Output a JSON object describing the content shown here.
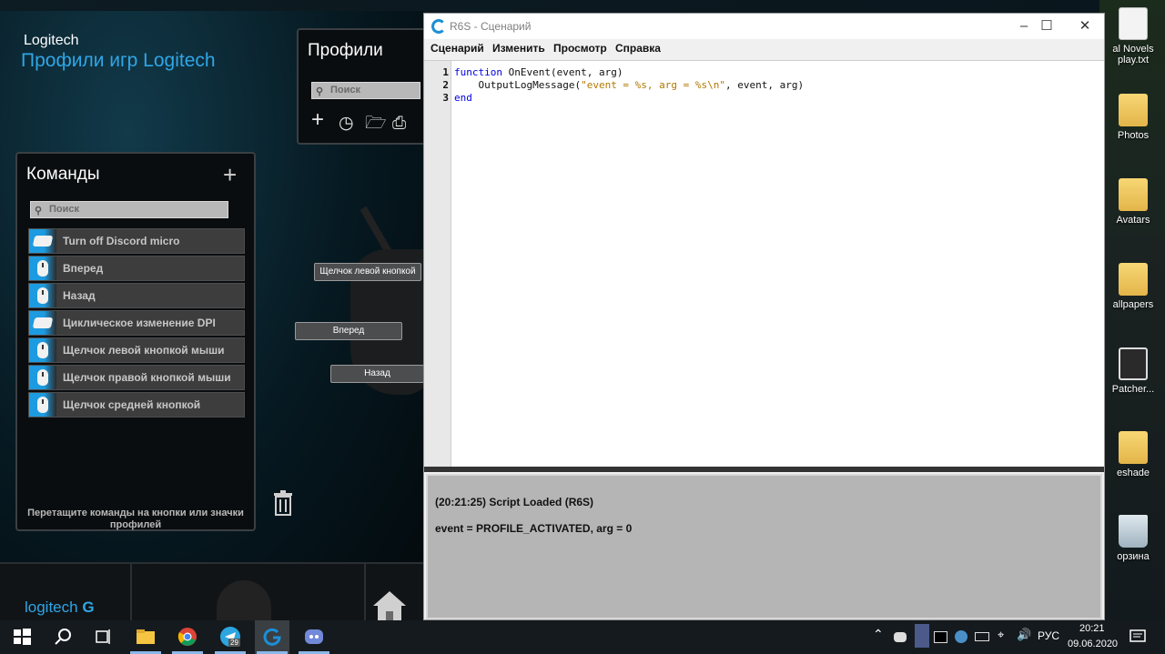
{
  "logitech": {
    "brand": "Logitech",
    "title": "Профили игр Logitech",
    "profiles": {
      "title": "Профили",
      "search_placeholder": "Поиск"
    },
    "commands": {
      "title": "Команды",
      "add": "+",
      "search_placeholder": "Поиск",
      "items": [
        {
          "label": "Turn off Discord micro",
          "icon": "keyboard-icon"
        },
        {
          "label": "Вперед",
          "icon": "mouse-icon"
        },
        {
          "label": "Назад",
          "icon": "mouse-icon"
        },
        {
          "label": "Циклическое изменение DPI",
          "icon": "keyboard-icon"
        },
        {
          "label": "Щелчок левой кнопкой мыши",
          "icon": "mouse-icon"
        },
        {
          "label": "Щелчок правой кнопкой мыши",
          "icon": "mouse-icon"
        },
        {
          "label": "Щелчок средней кнопкой",
          "icon": "mouse-icon"
        }
      ],
      "drag_hint": "Перетащите команды на кнопки или значки профилей"
    },
    "callouts": {
      "left_click": "Щелчок левой кнопкой",
      "forward": "Вперед",
      "back": "Назад"
    },
    "footer_logo": "logitech"
  },
  "editor": {
    "title": "R6S - Сценарий",
    "menu": [
      "Сценарий",
      "Изменить",
      "Просмотр",
      "Справка"
    ],
    "lines": [
      "1",
      "2",
      "3"
    ],
    "code": {
      "l1_kw": "function",
      "l1_rest": " OnEvent(event, arg)",
      "l2_pre": "    OutputLogMessage(",
      "l2_str": "\"event = %s, arg = %s\\n\"",
      "l2_post": ", event, arg)",
      "l3_kw": "end"
    },
    "output": [
      "(20:21:25) Script Loaded (R6S)",
      "event = PROFILE_ACTIVATED, arg = 0"
    ]
  },
  "desktop": {
    "icons": [
      "al Novels play.txt",
      "Photos",
      "Avatars",
      "allpapers",
      "Patcher...",
      "eshade",
      "орзина"
    ]
  },
  "taskbar": {
    "lang": "РУС",
    "time": "20:21",
    "date": "09.06.2020",
    "telegram_badge": "29"
  },
  "colors": {
    "logitech_blue": "#2fa6e6",
    "keyword_blue": "#0000e0",
    "string_gold": "#b07800"
  }
}
